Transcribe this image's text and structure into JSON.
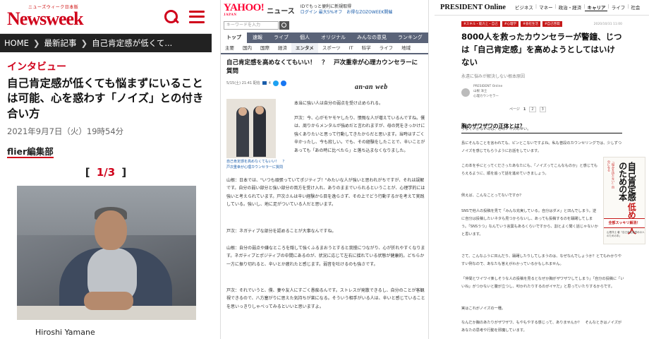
{
  "newsweek": {
    "logo_sub": "ニューズウィーク日本版",
    "logo": "Newsweek",
    "breadcrumb": [
      "HOME",
      "最新記事",
      "自己肯定感が低くて..."
    ],
    "kicker": "インタビュー",
    "title": "自己肯定感が低くても悩まずにいることは可能、心を惑わす「ノイズ」との付き合い方",
    "date": "2021年9月7日（火）19時54分",
    "author": "flier編集部",
    "pager": {
      "open": "[",
      "current": "1/3",
      "close": "]"
    },
    "photo_caption": "Hiroshi Yamane"
  },
  "yahoo": {
    "logo": "YAHOO!",
    "logo_sub": "JAPAN",
    "section": "ニュース",
    "promo_line1": "IDでもっと便利に新規取得",
    "promo_line2": "ログイン 最大5%オフ　お得なZOZOWEEK開催",
    "search_placeholder": "キーワードを入力",
    "nav": [
      "トップ",
      "速報",
      "ライブ",
      "個人",
      "オリジナル",
      "みんなの意見",
      "ランキング",
      "有料"
    ],
    "subnav": [
      "主要",
      "国内",
      "国際",
      "経済",
      "エンタメ",
      "スポーツ",
      "IT",
      "科学",
      "ライフ",
      "地域"
    ],
    "title": "自己肯定感を高めなくてもいい！　？　戸次重幸が心理カウンセラーに質問",
    "meta_date": "5/15(土) 21:41 配信",
    "meta_comments": "4",
    "source": "an·an web",
    "image_caption": "自己肯定感を高めなくてもいい！　？　戸次重幸が心理カウンセラーに質問",
    "paragraphs": [
      "本当に強い人は自分の弱点を受け止められる。",
      "戸次：今、心がモヤモヤしたり、憤慨な人が増えているんですね。僕は、周りからメンタルが強めだと言われますが、母の死をきっかけに強くありたいと思って行動してきたからだと思います。当時はすごく辛かったし、今も寂しい。でも、その経験をしたことで、辛いことがあっても「あの時に比べたら」と落ち込まなくなりました。",
      "山根：日本では、\"いつも頑張っていてポジティブ！\"みたいな人が強いと思われがちですが、それは誤解です。自分の弱い部分と強い部分の両方を受け入れ、ありのままでいられるということが、心理学的には強いと考えられています。戸次さんは辛い経験から目を逸らさず、その上でどう行動するかを考えて実践している。強いし、地に足がついている人だと思います。",
      "戸次：ネガティブな部分を認めることが大事なんですね。",
      "山根：自分の弱点や嫌なところを隠して強くふるまおうとすると我慢につながり、心が折れやすくなります。ネガティブとポジティブの中間にあるのが、状況に応じて左右に揺れている状態が健康的。どちらか一方に振り切れると、辛いとか疲れたと感じます。弱音を吐けるのも強さです。",
      "戸次：それでいうと、僕、妻や友人にすごく愚痴るんです。ストレスが発散できるし、自分のことが客観視できるので、八方塞がりに思えた気持ちが楽になる。そういう相手がいる人は、辛いと感じていることを思いっきりしゃべってみるといいと思いますよ。"
    ]
  },
  "president": {
    "logo": "PRESIDENT Online",
    "nav": [
      "ビジネス",
      "マネー",
      "政治・経済",
      "キャリア",
      "ライフ",
      "社会"
    ],
    "nav_active": 3,
    "tags": [
      "#スキル・能力上・自己",
      "#心理学",
      "#会社生活",
      "#自己啓発"
    ],
    "date": "2020/10/31 11:00",
    "title": "8000人を救ったカウンセラーが警鐘、じつは「自己肯定感」を高めようとしてはいけない",
    "subtitle": "永遠に悩みが解決しない根本原因",
    "author_label": "PRESIDENT Online",
    "author_name": "山根 洋士",
    "author_role": "心理カウンセラー",
    "pager_label": "ページ",
    "pages": [
      "1",
      "2",
      "3"
    ],
    "section_heading": "胸のザワザワの正体とは？",
    "paragraphs": [
      "うまくいかないのは、心のノイズのせい。",
      "島にそんなことを言われても、ピンとこないですよね。私も普段のカウンセリングでは、少しずつノイズを感じてもらうようにお話をしています。",
      "この本を手にとってくださったあなたにも、「ノイズってこんなものか」と感じてもらえるように、順を追って話を進めていきましょう。",
      "例えば、こんなことってないですか？",
      "SNSで他人の投稿を見て「みんな充実している。自分はダメ」と凹んでしまう。逆に自分は投稿したいネタも見つからないし、あっても投稿するのを躊躇してしまう。「SNSうつ」なんていう言葉もあるくらいですから、割とよく聞く話じゃないかと思います。",
      "さて、こんなふうに凹んだり、躊躇したりしてしまうのは、なぜなんでしょうか？とてもわかりやすい例なので、あなたも答えがわかっているかもしれません。",
      "「仲間とワイワイ楽しそうな人の投稿を見るとなぜか胸がザワザワしてしまう」「自分の投稿に「いいね」がつかないと腹が立つし、叩かれたりするのがイヤだ」と思っていたりするからです。",
      "実はこれがノイズの一種。",
      "なんだか胸のあたりがザワザワ、もやもやする感じって、ありませんか？　そんなときはノイズがあなたの思考や行動を邪魔しています。"
    ],
    "book": {
      "top_line": "「悩みを持たない」自分になる",
      "title_part1": "自己肯定感",
      "title_part2": "低めの人",
      "title_part3": "のための本",
      "band": "全部スッキリ解消！",
      "footer": "山根洋士 著「自己肯定感低めの人のための本」"
    }
  }
}
